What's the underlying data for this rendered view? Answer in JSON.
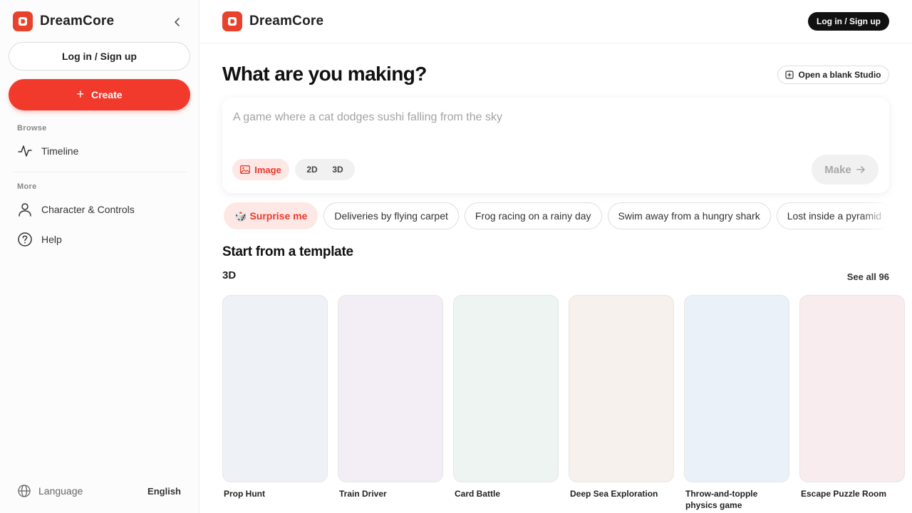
{
  "app": {
    "name": "DreamCore",
    "accent": "#f23a2c"
  },
  "sidebar": {
    "login_label": "Log in / Sign up",
    "create_label": "Create",
    "browse_label": "Browse",
    "browse_items": [
      {
        "label": "Timeline",
        "icon": "activity-icon"
      }
    ],
    "more_label": "More",
    "more_items": [
      {
        "label": "Character & Controls",
        "icon": "user-icon"
      },
      {
        "label": "Help",
        "icon": "help-icon"
      }
    ],
    "language_label": "Language",
    "language_value": "English"
  },
  "header": {
    "login_label": "Log in / Sign up"
  },
  "main": {
    "headline": "What are you making?",
    "blank_studio_label": "Open a blank Studio",
    "prompt": {
      "placeholder": "A game where a cat dodges sushi falling from the sky",
      "image_label": "Image",
      "dim_2d": "2D",
      "dim_3d": "3D",
      "make_label": "Make"
    },
    "suggestions": [
      "Surprise me",
      "Deliveries by flying carpet",
      "Frog racing on a rainy day",
      "Swim away from a hungry shark",
      "Lost inside a pyramid"
    ],
    "template_heading": "Start from a template",
    "category": "3D",
    "see_all": "See all 96",
    "templates": [
      {
        "title": "Prop Hunt",
        "color": "#eef1f6"
      },
      {
        "title": "Train Driver",
        "color": "#f3eef5"
      },
      {
        "title": "Card Battle",
        "color": "#eef4f1"
      },
      {
        "title": "Deep Sea Exploration",
        "color": "#f6f1ec"
      },
      {
        "title": "Throw-and-topple physics game",
        "color": "#ebf1f8"
      },
      {
        "title": "Escape Puzzle Room",
        "color": "#f8ecef"
      }
    ]
  }
}
